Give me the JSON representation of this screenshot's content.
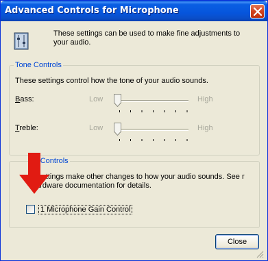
{
  "window": {
    "title": "Advanced Controls for Microphone",
    "title_color": "#ffffff",
    "titlebar_color": "#0a5fe3",
    "close_icon": "close-icon"
  },
  "intro": {
    "icon": "settings-panel-icon",
    "text": "These settings can be used to make fine adjustments to your audio."
  },
  "tone_controls": {
    "label": "Tone Controls",
    "description": "These settings control how the tone of your audio sounds.",
    "sliders": [
      {
        "label": "Bass",
        "low": "Low",
        "high": "High",
        "level": 0
      },
      {
        "label": "Treble",
        "low": "Low",
        "high": "High",
        "level": 0
      }
    ]
  },
  "other_controls": {
    "label": "r Controls",
    "description": "e settings make other changes to how your audio sounds.  See r hardware documentation for details.",
    "checkbox": {
      "label": "1  Microphone Gain Control",
      "checked": false
    }
  },
  "overlay": {
    "arrow_icon": "red-arrow-icon",
    "arrow_color": "#e11b12"
  },
  "buttons": {
    "close": "Close"
  },
  "colors": {
    "group_label": "#0046d5",
    "disabled_text": "#a6a69a",
    "window_bg": "#ece9d8"
  }
}
